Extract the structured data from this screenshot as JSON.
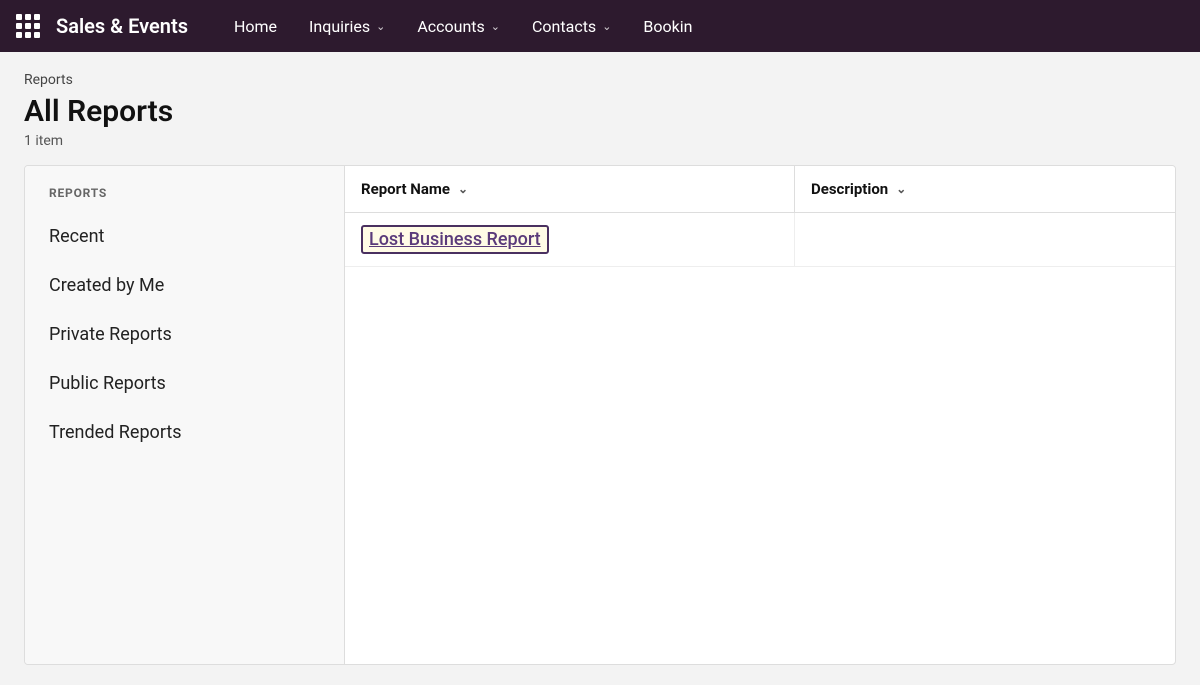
{
  "navbar": {
    "brand": "Sales & Events",
    "grid_icon_label": "grid-menu",
    "nav_items": [
      {
        "label": "Home",
        "has_chevron": false
      },
      {
        "label": "Inquiries",
        "has_chevron": true
      },
      {
        "label": "Accounts",
        "has_chevron": true
      },
      {
        "label": "Contacts",
        "has_chevron": true
      },
      {
        "label": "Bookin",
        "has_chevron": false
      }
    ]
  },
  "page": {
    "breadcrumb": "Reports",
    "title": "All Reports",
    "item_count": "1 item"
  },
  "sidebar": {
    "header": "REPORTS",
    "items": [
      {
        "label": "Recent"
      },
      {
        "label": "Created by Me"
      },
      {
        "label": "Private Reports"
      },
      {
        "label": "Public Reports"
      },
      {
        "label": "Trended Reports"
      }
    ]
  },
  "table": {
    "columns": [
      {
        "label": "Report Name",
        "has_chevron": true
      },
      {
        "label": "Description",
        "has_chevron": true
      }
    ],
    "rows": [
      {
        "name": "Lost Business Report",
        "description": ""
      }
    ]
  }
}
